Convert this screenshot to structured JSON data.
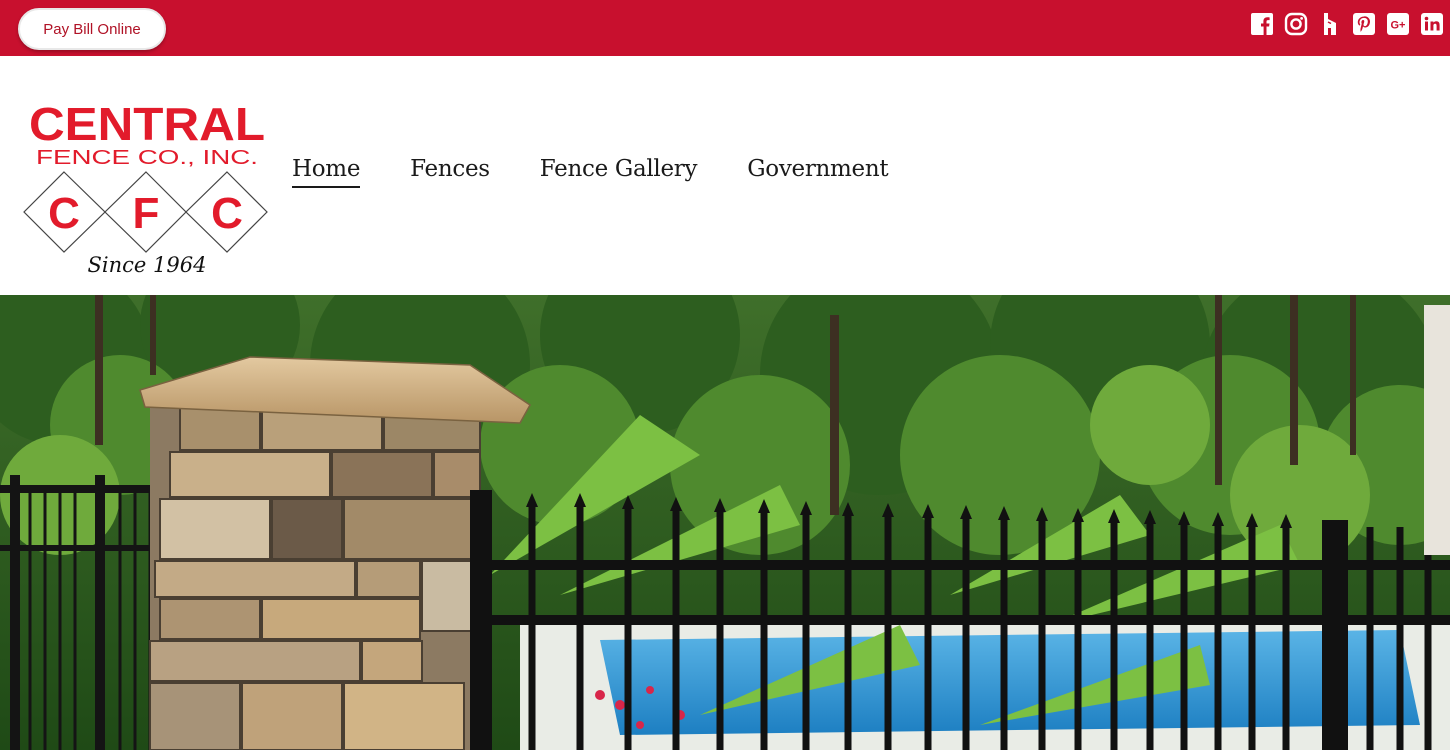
{
  "topbar": {
    "pay_button_label": "Pay Bill Online",
    "background_color": "#c8102e",
    "social_icons": [
      "facebook-icon",
      "instagram-icon",
      "houzz-icon",
      "pinterest-icon",
      "google-plus-icon",
      "linkedin-icon"
    ]
  },
  "logo": {
    "line1": "CENTRAL",
    "line2": "FENCE CO., INC.",
    "letters": [
      "C",
      "F",
      "C"
    ],
    "tagline": "Since 1964",
    "brand_color": "#e21b2b"
  },
  "nav": {
    "items": [
      {
        "label": "Home",
        "active": true
      },
      {
        "label": "Fences",
        "active": false
      },
      {
        "label": "Fence Gallery",
        "active": false
      },
      {
        "label": "Government",
        "active": false
      }
    ]
  },
  "hero": {
    "image_description": "black aluminum fence with stone pillar in front of pool and trees"
  }
}
